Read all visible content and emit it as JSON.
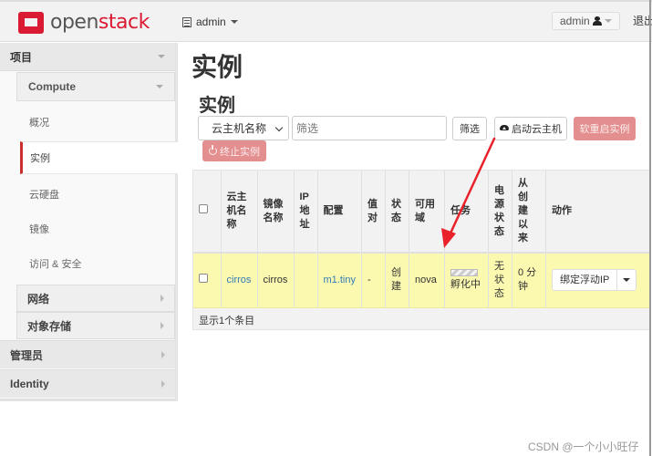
{
  "navbar": {
    "logo_open": "open",
    "logo_stack": "stack",
    "project": "admin",
    "user": "admin",
    "logout": "退出"
  },
  "sidebar": {
    "project": "项目",
    "compute": "Compute",
    "items": [
      {
        "label": "概况",
        "active": false
      },
      {
        "label": "实例",
        "active": true
      },
      {
        "label": "云硬盘",
        "active": false
      },
      {
        "label": "镜像",
        "active": false
      },
      {
        "label": "访问 & 安全",
        "active": false
      }
    ],
    "network": "网络",
    "object_store": "对象存储",
    "admin": "管理员",
    "identity": "Identity"
  },
  "main": {
    "page_title": "实例",
    "section_title": "实例",
    "filter_select": "云主机名称",
    "filter_placeholder": "筛选",
    "filter_button": "筛选",
    "launch_button": "启动云主机",
    "soft_reboot_button": "软重启实例",
    "terminate_button": "终止实例"
  },
  "table": {
    "headers": {
      "name": "云主机名称",
      "image": "镜像名称",
      "ip": "IP地址",
      "flavor": "配置",
      "keypair": "值对",
      "status": "状态",
      "az": "可用域",
      "task": "任务",
      "power": "电源状态",
      "age": "从创建以来",
      "actions": "动作"
    },
    "rows": [
      {
        "name": "cirros",
        "image": "cirros",
        "ip": "",
        "flavor": "m1.tiny",
        "keypair": "-",
        "status": "创建",
        "az": "nova",
        "task": "孵化中",
        "power": "无状态",
        "age": "0 分钟",
        "action": "绑定浮动IP"
      }
    ],
    "footer": "显示1个条目"
  },
  "watermark": "CSDN @一个小小旺仔",
  "colors": {
    "brand_red": "#da1a32",
    "danger_button": "#e48f8f",
    "row_highlight": "#fbf9b0",
    "link": "#337ab7",
    "annotation_arrow": "#e8212b"
  }
}
